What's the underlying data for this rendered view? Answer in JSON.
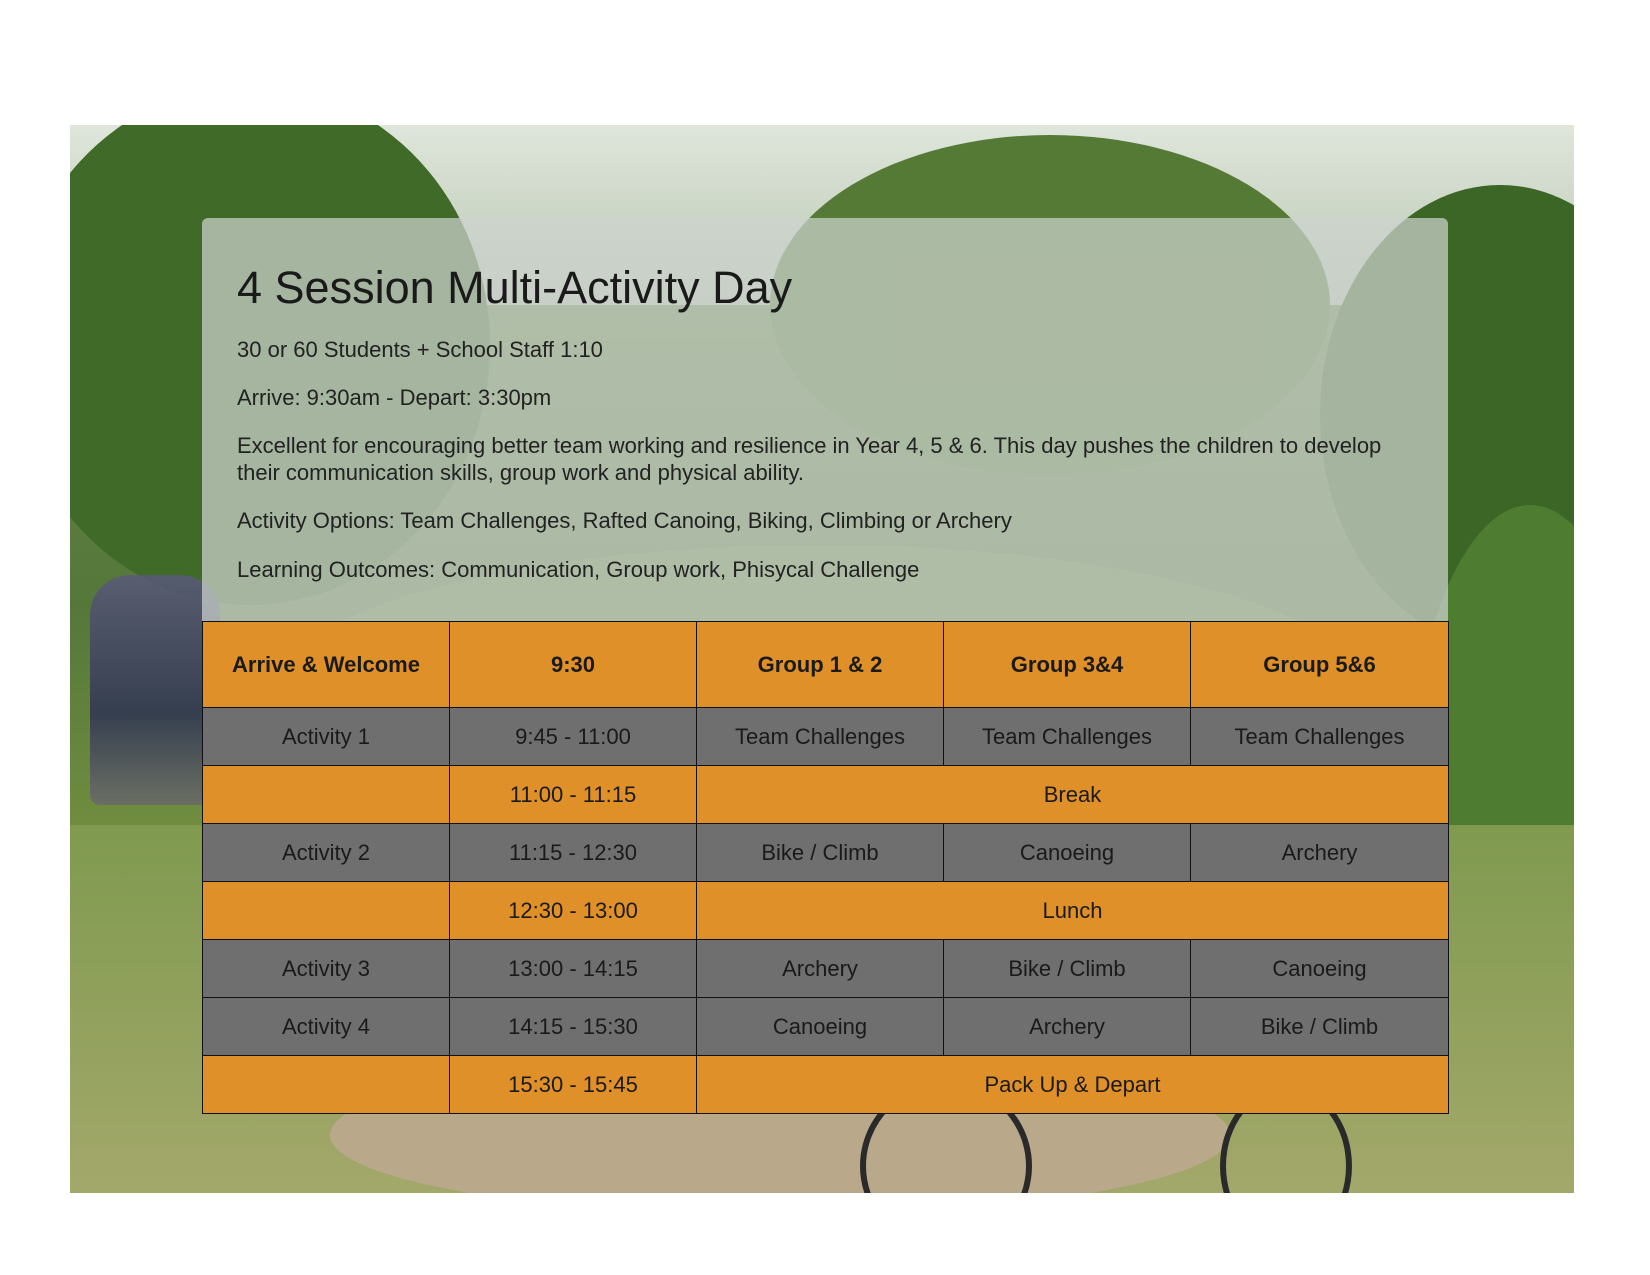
{
  "panel": {
    "title": "4 Session Multi-Activity Day",
    "students": "30 or 60 Students + School Staff 1:10",
    "times": "Arrive: 9:30am - Depart: 3:30pm",
    "description": "Excellent for encouraging better team working and resilience in Year 4, 5 & 6. This day pushes the children to develop their communication skills, group work and physical ability.",
    "activity_options": "Activity Options: Team Challenges, Rafted Canoing, Biking, Climbing or Archery",
    "learning_outcomes": "Learning Outcomes: Communication, Group work, Phisycal Challenge"
  },
  "colors": {
    "orange": "#e09028",
    "grey": "#6f6f6f",
    "panel": "#cdd2ce"
  },
  "table": {
    "header": [
      "Arrive & Welcome",
      "9:30",
      "Group 1 & 2",
      "Group 3&4",
      "Group 5&6"
    ],
    "rows": [
      {
        "label": "Activity 1",
        "time": "9:45 - 11:00",
        "g12": "Team Challenges",
        "g34": "Team Challenges",
        "g56": "Team Challenges"
      },
      {
        "label": "",
        "time": "11:00 - 11:15",
        "span": "Break"
      },
      {
        "label": "Activity 2",
        "time": "11:15 - 12:30",
        "g12": "Bike / Climb",
        "g34": "Canoeing",
        "g56": "Archery"
      },
      {
        "label": "",
        "time": "12:30 - 13:00",
        "span": "Lunch"
      },
      {
        "label": "Activity 3",
        "time": "13:00 - 14:15",
        "g12": "Archery",
        "g34": "Bike / Climb",
        "g56": "Canoeing"
      },
      {
        "label": "Activity 4",
        "time": "14:15 - 15:30",
        "g12": "Canoeing",
        "g34": "Archery",
        "g56": "Bike / Climb"
      },
      {
        "label": "",
        "time": "15:30 - 15:45",
        "span": "Pack Up & Depart"
      }
    ]
  }
}
